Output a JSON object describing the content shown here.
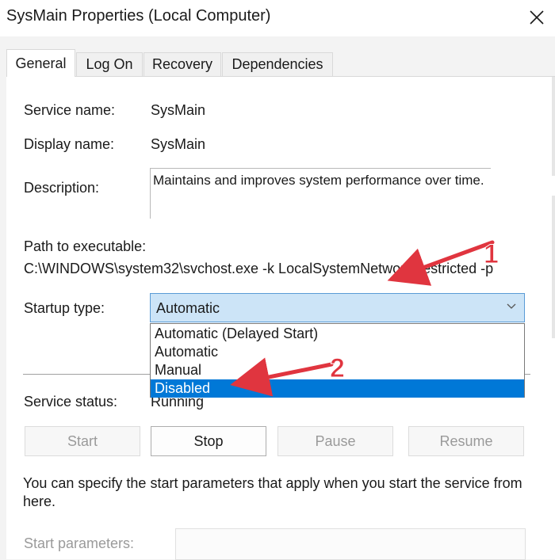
{
  "window": {
    "title": "SysMain Properties (Local Computer)"
  },
  "tabs": [
    {
      "label": "General",
      "active": true
    },
    {
      "label": "Log On"
    },
    {
      "label": "Recovery"
    },
    {
      "label": "Dependencies"
    }
  ],
  "general": {
    "service_name_label": "Service name:",
    "service_name": "SysMain",
    "display_name_label": "Display name:",
    "display_name": "SysMain",
    "description_label": "Description:",
    "description": "Maintains and improves system performance over time.",
    "path_label": "Path to executable:",
    "path": "C:\\WINDOWS\\system32\\svchost.exe -k LocalSystemNetworkRestricted -p",
    "startup_type_label": "Startup type:",
    "startup_type_value": "Automatic",
    "startup_options": [
      "Automatic (Delayed Start)",
      "Automatic",
      "Manual",
      "Disabled"
    ],
    "startup_highlighted": "Disabled",
    "service_status_label": "Service status:",
    "service_status": "Running",
    "buttons": {
      "start": "Start",
      "stop": "Stop",
      "pause": "Pause",
      "resume": "Resume"
    },
    "hint": "You can specify the start parameters that apply when you start the service from here.",
    "start_params_label": "Start parameters:"
  },
  "annotations": {
    "marker1": "1",
    "marker2": "2",
    "color": "#e0353f"
  }
}
